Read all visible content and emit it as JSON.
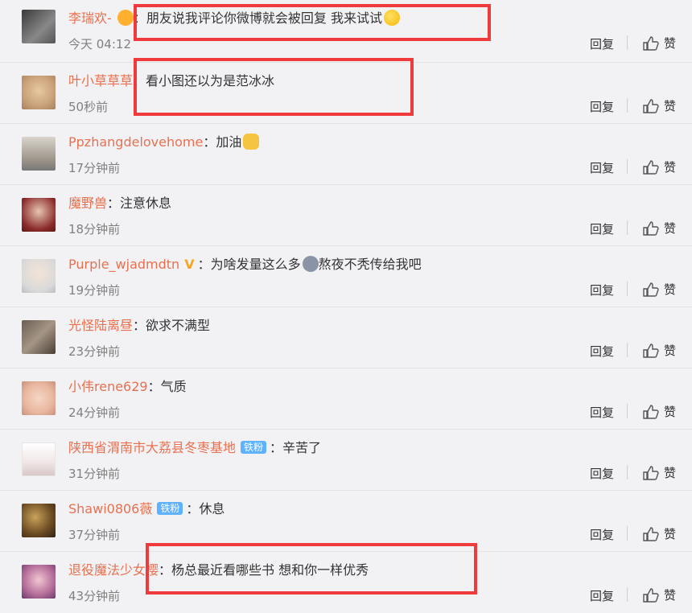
{
  "comments": [
    {
      "user": "李瑞欢-",
      "text": "朋友说我评论你微博就会被回复 我来试试",
      "time": "今天 04:12",
      "reply": "回复",
      "like": "赞"
    },
    {
      "user": "叶小草草草",
      "text": "看小图还以为是范冰冰",
      "time": "50秒前",
      "reply": "回复",
      "like": "赞"
    },
    {
      "user": "Ppzhangdelovehome",
      "text": "加油",
      "time": "17分钟前",
      "reply": "回复",
      "like": "赞"
    },
    {
      "user": "魔野兽",
      "text": "注意休息",
      "time": "18分钟前",
      "reply": "回复",
      "like": "赞"
    },
    {
      "user": "Purple_wjadmdtn",
      "text": "为啥发量这么多",
      "text2": "熬夜不秃传给我吧",
      "time": "19分钟前",
      "reply": "回复",
      "like": "赞"
    },
    {
      "user": "光怪陆离昼",
      "text": "欲求不满型",
      "time": "23分钟前",
      "reply": "回复",
      "like": "赞"
    },
    {
      "user": "小伟rene629",
      "text": "气质",
      "time": "24分钟前",
      "reply": "回复",
      "like": "赞"
    },
    {
      "user": "陕西省渭南市大荔县冬枣基地",
      "badge": "铁粉",
      "text": "辛苦了",
      "time": "31分钟前",
      "reply": "回复",
      "like": "赞"
    },
    {
      "user": "Shawi0806薇",
      "badge": "铁粉",
      "text": "休息",
      "time": "37分钟前",
      "reply": "回复",
      "like": "赞"
    },
    {
      "user": "退役魔法少女樱",
      "text": "杨总最近看哪些书 想和你一样优秀",
      "time": "43分钟前",
      "reply": "回复",
      "like": "赞"
    }
  ],
  "colors": {
    "username": "#e8704f",
    "highlight": "#ef3b3b",
    "badge": "#5eb2ff",
    "v_badge": "#f5a623"
  }
}
